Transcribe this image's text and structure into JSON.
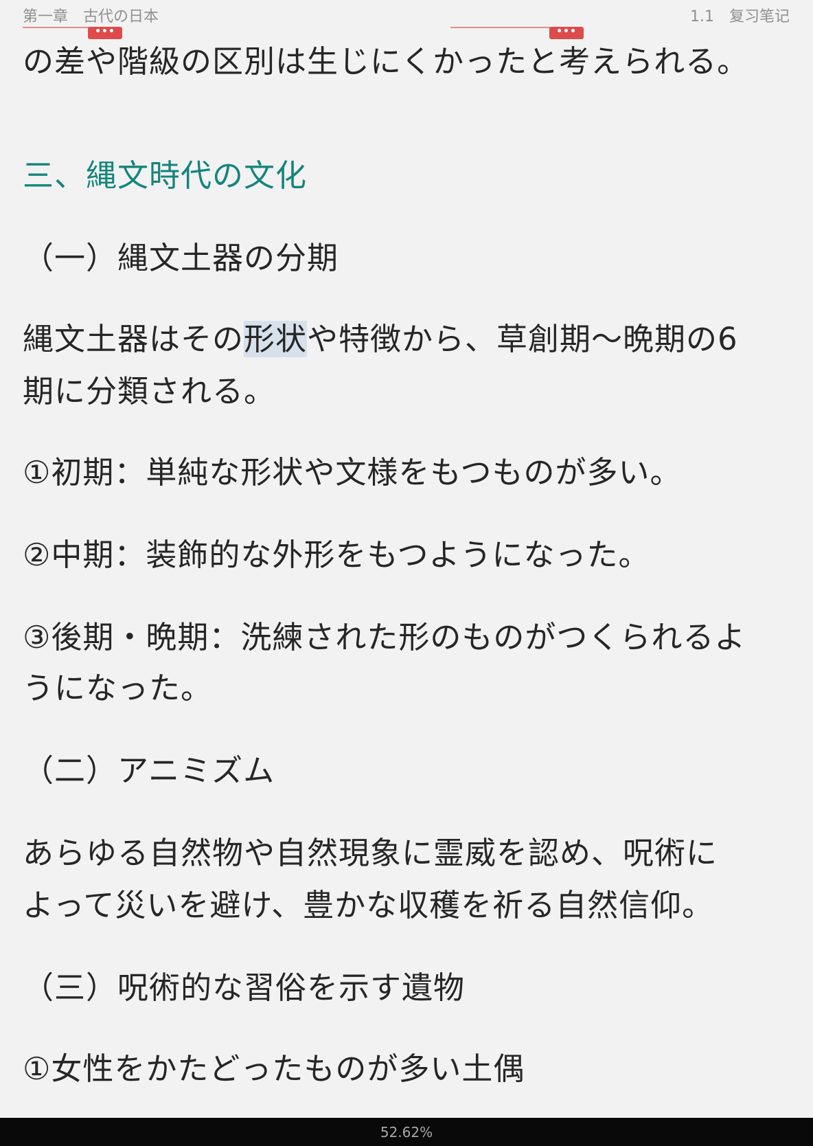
{
  "header": {
    "chapter": "第一章　古代の日本",
    "section": "1.1　复习笔记"
  },
  "note_marker": {
    "label": "•••"
  },
  "content": {
    "continuation": "の差や階級の区別は生じにくかったと考えられる。",
    "heading": "三、縄文時代の文化",
    "sub1": "（一）縄文土器の分期",
    "para1_before": "縄文土器はその",
    "para1_highlight": "形状",
    "para1_after": "や特徴から、草創期～晩期の6",
    "para1_line2": "期に分類される。",
    "item1": "①初期：単純な形状や文様をもつものが多い。",
    "item2": "②中期：装飾的な外形をもつようになった。",
    "item3_line1": "③後期・晩期：洗練された形のものがつくられるよ",
    "item3_line2": "うになった。",
    "sub2": "（二）アニミズム",
    "para2_line1": "あらゆる自然物や自然現象に霊威を認め、呪術に",
    "para2_line2": "よって災いを避け、豊かな収穫を祈る自然信仰。",
    "sub3": "（三）呪術的な習俗を示す遺物",
    "item4": "①女性をかたどったものが多い土偶"
  },
  "footer": {
    "progress": "52.62%"
  },
  "colors": {
    "background": "#f2f2f2",
    "heading": "#14857c",
    "note_marker": "#dd4b4b",
    "highlight": "#d6e1ec",
    "footer": "#090909"
  }
}
